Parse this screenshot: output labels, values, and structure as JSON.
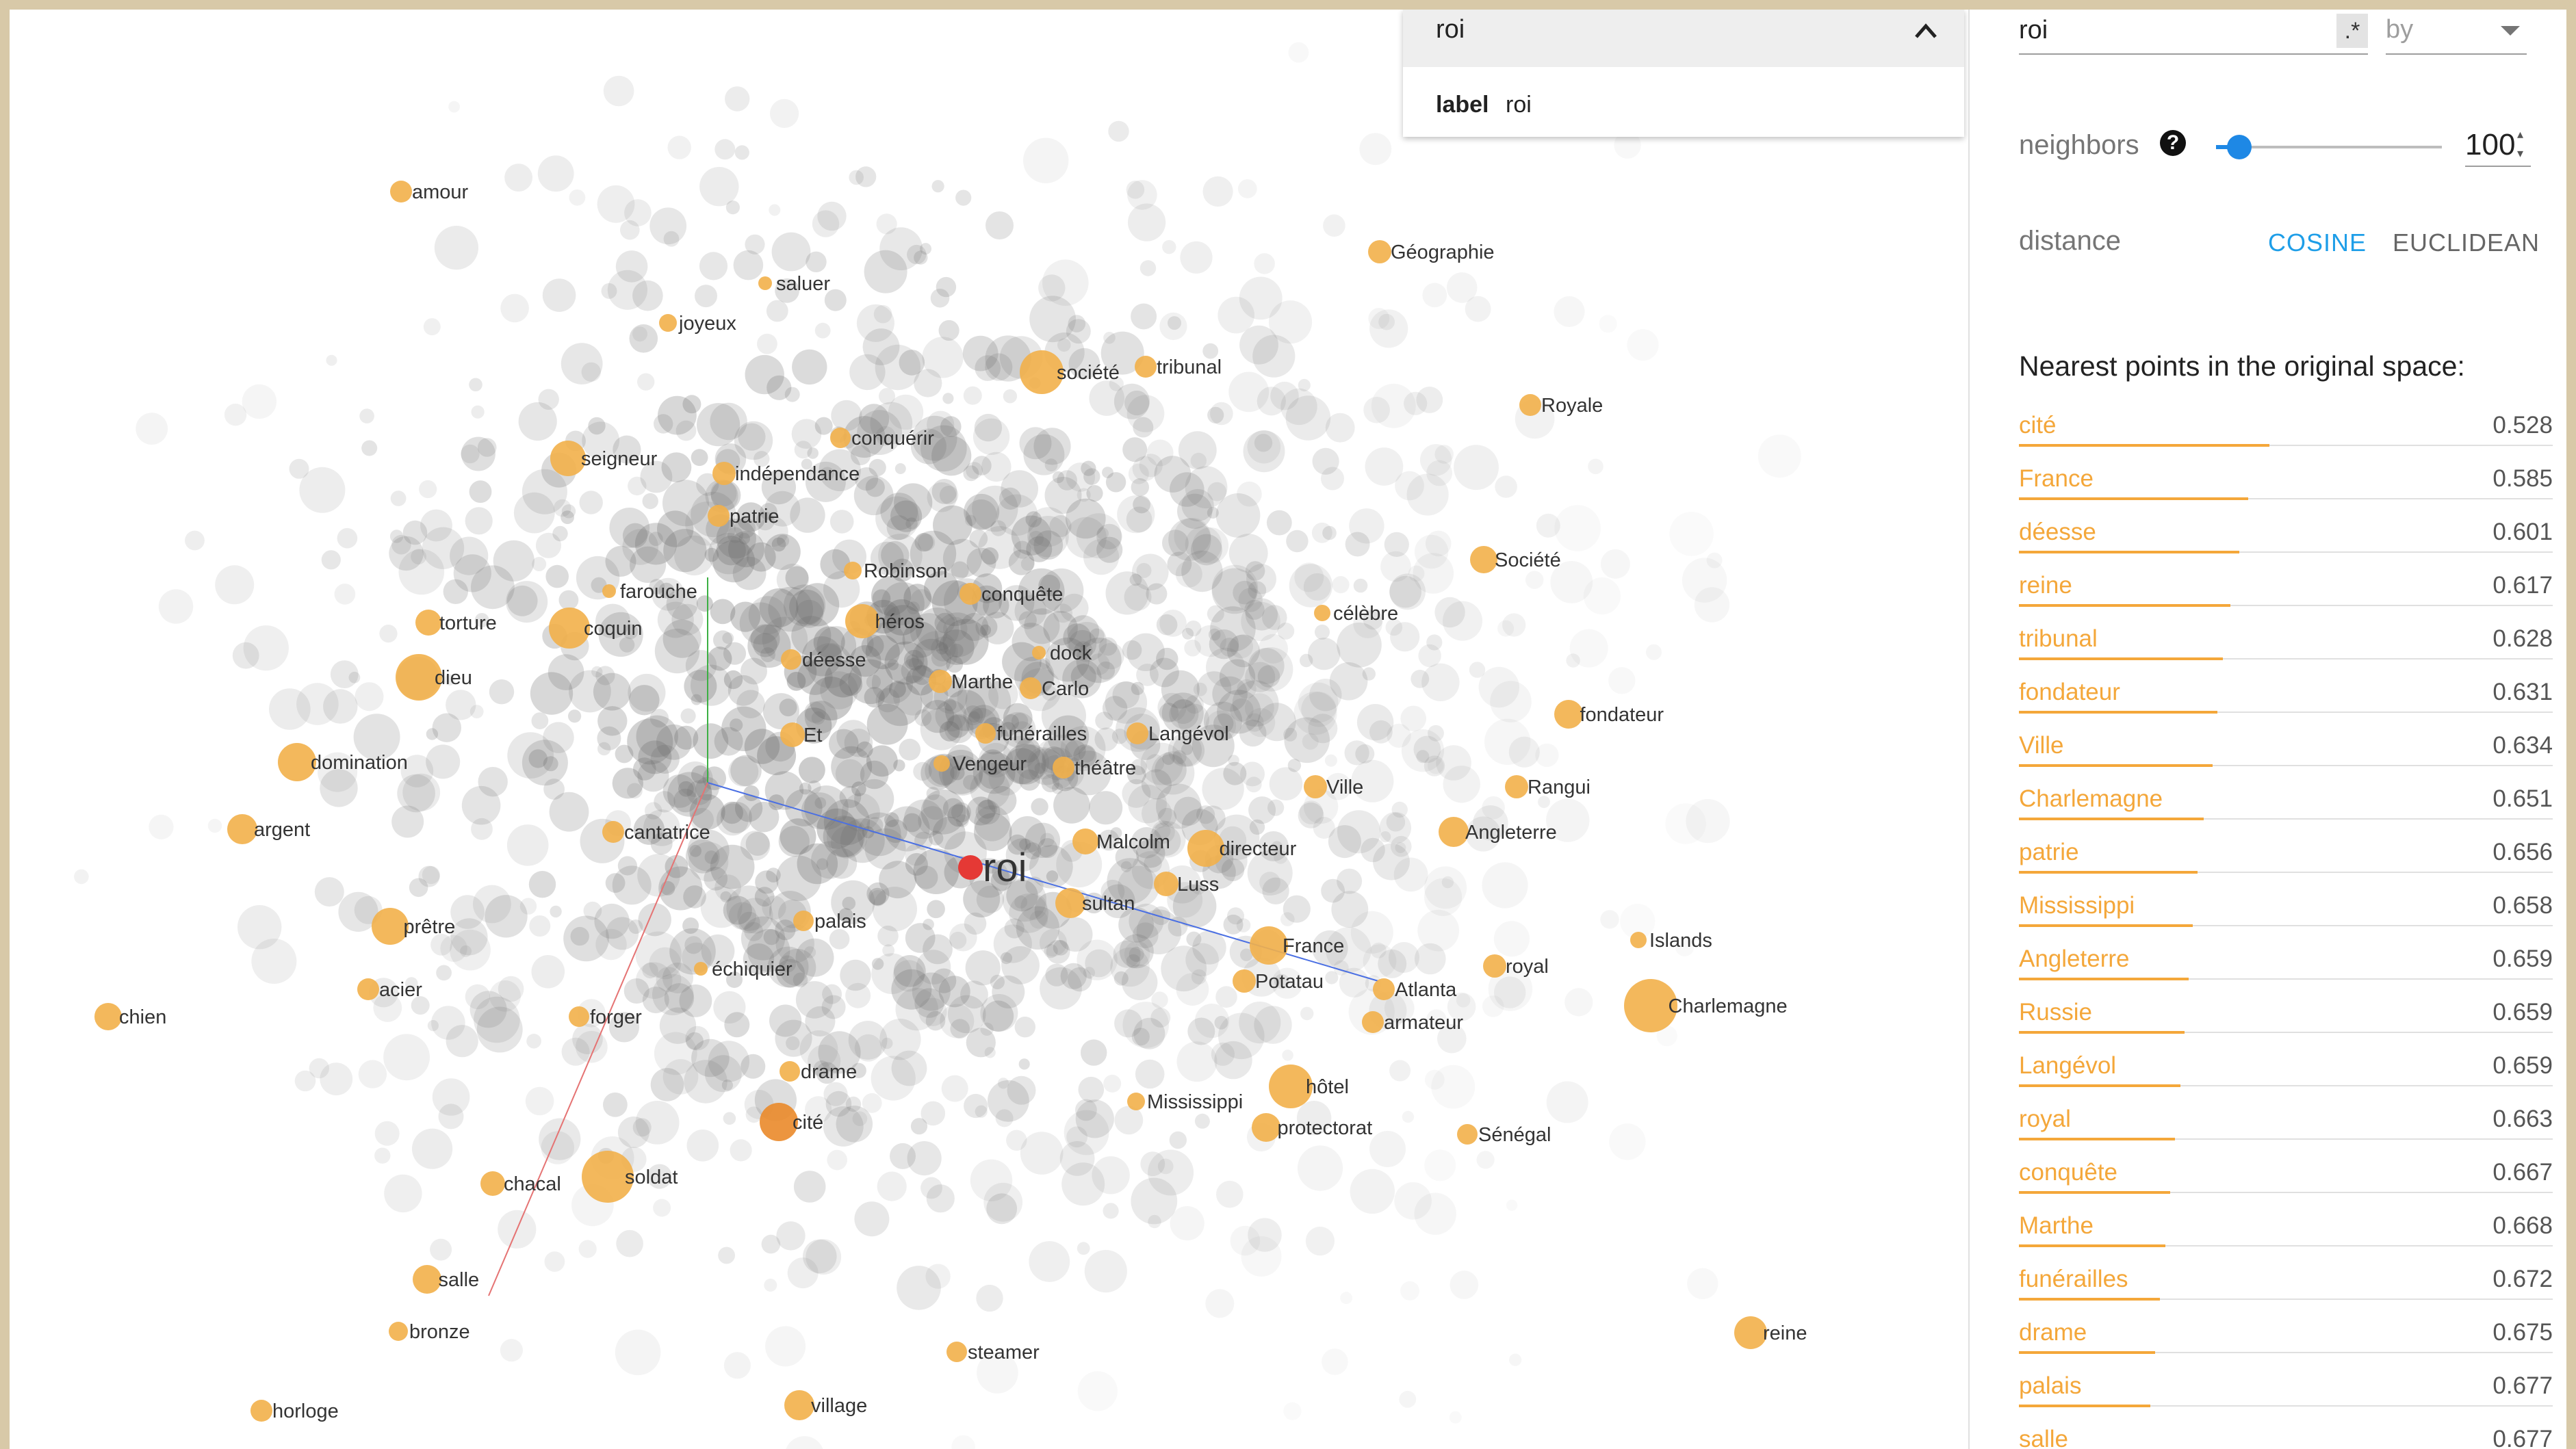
{
  "selection": {
    "title": "roi",
    "label_key": "label",
    "label_value": "roi"
  },
  "search": {
    "value": "roi",
    "regex_label": ".*",
    "by_label": "by"
  },
  "neighbors": {
    "label": "neighbors",
    "help": "?",
    "value": "100",
    "slider_fraction": 0.1
  },
  "distance": {
    "label": "distance",
    "options": [
      "COSINE",
      "EUCLIDEAN"
    ],
    "selected": "COSINE"
  },
  "nearest": {
    "title": "Nearest points in the original space:",
    "items": [
      {
        "word": "cité",
        "score": "0.528"
      },
      {
        "word": "France",
        "score": "0.585"
      },
      {
        "word": "déesse",
        "score": "0.601"
      },
      {
        "word": "reine",
        "score": "0.617"
      },
      {
        "word": "tribunal",
        "score": "0.628"
      },
      {
        "word": "fondateur",
        "score": "0.631"
      },
      {
        "word": "Ville",
        "score": "0.634"
      },
      {
        "word": "Charlemagne",
        "score": "0.651"
      },
      {
        "word": "patrie",
        "score": "0.656"
      },
      {
        "word": "Mississippi",
        "score": "0.658"
      },
      {
        "word": "Angleterre",
        "score": "0.659"
      },
      {
        "word": "Russie",
        "score": "0.659"
      },
      {
        "word": "Langévol",
        "score": "0.659"
      },
      {
        "word": "royal",
        "score": "0.663"
      },
      {
        "word": "conquête",
        "score": "0.667"
      },
      {
        "word": "Marthe",
        "score": "0.668"
      },
      {
        "word": "funérailles",
        "score": "0.672"
      },
      {
        "word": "drame",
        "score": "0.675"
      },
      {
        "word": "palais",
        "score": "0.677"
      },
      {
        "word": "salle",
        "score": "0.677"
      }
    ]
  },
  "projection": {
    "selected_label": "roi",
    "labels": [
      "amour",
      "saluer",
      "joyeux",
      "société",
      "tribunal",
      "Géographie",
      "Royale",
      "seigneur",
      "conquérir",
      "indépendance",
      "patrie",
      "Société",
      "Robinson",
      "farouche",
      "conquête",
      "torture",
      "coquin",
      "héros",
      "célèbre",
      "dock",
      "déesse",
      "dieu",
      "Marthe",
      "Carlo",
      "fondateur",
      "funérailles",
      "Langévol",
      "Et",
      "domination",
      "Vengeur",
      "théâtre",
      "Ville",
      "Rangui",
      "argent",
      "cantatrice",
      "Angleterre",
      "Malcolm",
      "directeur",
      "Luss",
      "sultan",
      "prêtre",
      "palais",
      "Islands",
      "France",
      "échiquier",
      "royal",
      "acier",
      "Potatau",
      "Atlanta",
      "Charlemagne",
      "chien",
      "forger",
      "armateur",
      "drame",
      "hôtel",
      "Mississippi",
      "cité",
      "protectorat",
      "Sénégal",
      "chacal",
      "soldat",
      "salle",
      "bronze",
      "reine",
      "steamer",
      "horloge",
      "village"
    ]
  },
  "colors": {
    "highlight": "#f4a73a",
    "selected": "#e53935",
    "accent": "#1e88e5"
  }
}
